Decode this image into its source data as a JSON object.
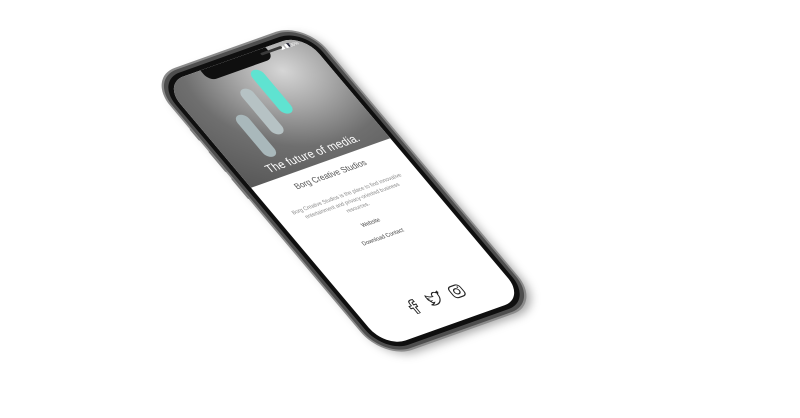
{
  "status_bar": {
    "battery": "85%"
  },
  "hero": {
    "tagline": "The future of media."
  },
  "content": {
    "company_name": "Borg Creative Studios",
    "description": "Borg Creative Studios is the place to find innovative entertainment and privacy-oriented business resources.",
    "website_label": "Website",
    "download_contact_label": "Download Contact"
  },
  "social": {
    "icons": [
      "facebook-icon",
      "twitter-icon",
      "instagram-icon"
    ]
  },
  "colors": {
    "accent": "#5fe3d1",
    "bar_gray": "#a9b8bb",
    "phone_body": "#4e4e4e",
    "hero_background": "#6f6f6f"
  }
}
